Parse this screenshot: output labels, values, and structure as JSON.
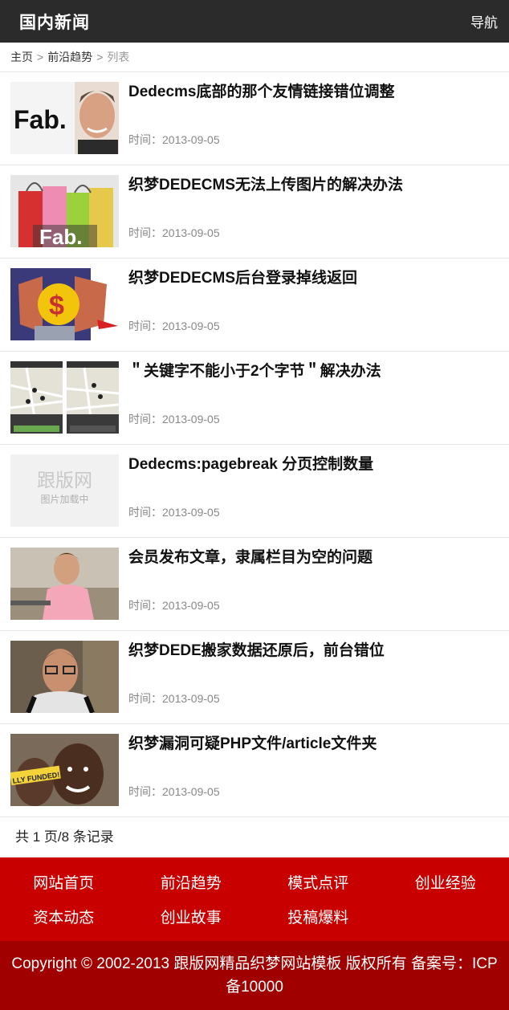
{
  "header": {
    "title": "国内新闻",
    "nav_label": "导航"
  },
  "breadcrumb": {
    "home": "主页",
    "section": "前沿趋势",
    "current": "列表",
    "sep": ">"
  },
  "articles": [
    {
      "title": "Dedecms底部的那个友情链接错位调整",
      "time": "时间：2013-09-05",
      "thumb": "fab-man-photo"
    },
    {
      "title": "织梦DEDECMS无法上传图片的解决办法",
      "time": "时间：2013-09-05",
      "thumb": "shopping-bags-photo"
    },
    {
      "title": "织梦DEDECMS后台登录掉线返回",
      "time": "时间：2013-09-05",
      "thumb": "dollar-sign-illustration"
    },
    {
      "title": "＂关键字不能小于2个字节＂解决办法",
      "time": "时间：2013-09-05",
      "thumb": "map-app-screenshots"
    },
    {
      "title": "Dedecms:pagebreak 分页控制数量",
      "time": "时间：2013-09-05",
      "thumb": "image-loading-placeholder",
      "placeholder_brand": "跟版网",
      "placeholder_text": "图片加载中"
    },
    {
      "title": "会员发布文章，隶属栏目为空的问题",
      "time": "时间：2013-09-05",
      "thumb": "man-pink-shirt-photo"
    },
    {
      "title": "织梦DEDE搬家数据还原后，前台错位",
      "time": "时间：2013-09-05",
      "thumb": "man-glasses-photo"
    },
    {
      "title": "织梦漏洞可疑PHP文件/article文件夹",
      "time": "时间：2013-09-05",
      "thumb": "child-smiling-photo",
      "thumb_text": "LLY FUNDED!"
    }
  ],
  "pagination": {
    "text": "共 1 页/8 条记录"
  },
  "footer": {
    "links": [
      "网站首页",
      "前沿趋势",
      "模式点评",
      "创业经验",
      "资本动态",
      "创业故事",
      "投稿爆料"
    ],
    "copyright": "Copyright © 2002-2013 跟版网精品织梦网站模板 版权所有 备案号：ICP备10000"
  },
  "colors": {
    "header_bg": "#2b2b2b",
    "footer_nav_bg": "#c80000",
    "copyright_bg": "#a00000"
  }
}
